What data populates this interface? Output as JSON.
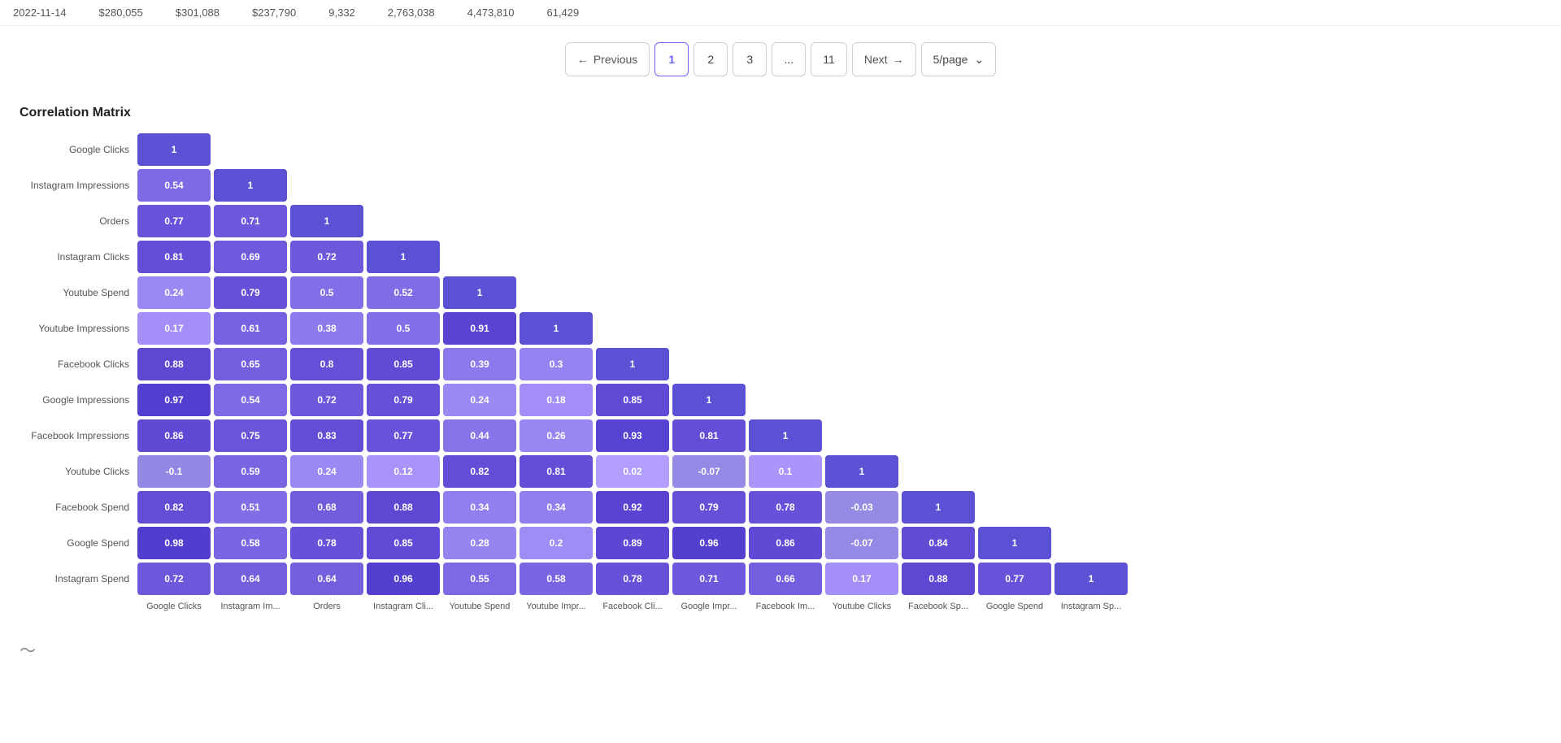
{
  "topRow": {
    "date": "2022-11-14",
    "col1": "$280,055",
    "col2": "$301,088",
    "col3": "$237,790",
    "col4": "9,332",
    "col5": "2,763,038",
    "col6": "4,473,810",
    "col7": "61,429"
  },
  "pagination": {
    "prev_label": "Previous",
    "next_label": "Next",
    "pages": [
      "1",
      "2",
      "3",
      "...",
      "11"
    ],
    "active_page": "1",
    "per_page": "5/page"
  },
  "section": {
    "title": "Correlation Matrix"
  },
  "matrix": {
    "rowLabels": [
      "Google Clicks",
      "Instagram Impressions",
      "Orders",
      "Instagram Clicks",
      "Youtube Spend",
      "Youtube Impressions",
      "Facebook Clicks",
      "Google Impressions",
      "Facebook Impressions",
      "Youtube Clicks",
      "Facebook Spend",
      "Google Spend",
      "Instagram Spend"
    ],
    "colLabels": [
      "Google Clicks",
      "Instagram Im...",
      "Orders",
      "Instagram Cli...",
      "Youtube Spend",
      "Youtube Impr...",
      "Facebook Cli...",
      "Google Impr...",
      "Facebook Im...",
      "Youtube Clicks",
      "Facebook Sp...",
      "Google Spend",
      "Instagram Sp..."
    ],
    "cells": [
      [
        1,
        null,
        null,
        null,
        null,
        null,
        null,
        null,
        null,
        null,
        null,
        null,
        null
      ],
      [
        0.54,
        1,
        null,
        null,
        null,
        null,
        null,
        null,
        null,
        null,
        null,
        null,
        null
      ],
      [
        0.77,
        0.71,
        1,
        null,
        null,
        null,
        null,
        null,
        null,
        null,
        null,
        null,
        null
      ],
      [
        0.81,
        0.69,
        0.72,
        1,
        null,
        null,
        null,
        null,
        null,
        null,
        null,
        null,
        null
      ],
      [
        0.24,
        0.79,
        0.5,
        0.52,
        1,
        null,
        null,
        null,
        null,
        null,
        null,
        null,
        null
      ],
      [
        0.17,
        0.61,
        0.38,
        0.5,
        0.91,
        1,
        null,
        null,
        null,
        null,
        null,
        null,
        null
      ],
      [
        0.88,
        0.65,
        0.8,
        0.85,
        0.39,
        0.3,
        1,
        null,
        null,
        null,
        null,
        null,
        null
      ],
      [
        0.97,
        0.54,
        0.72,
        0.79,
        0.24,
        0.18,
        0.85,
        1,
        null,
        null,
        null,
        null,
        null
      ],
      [
        0.86,
        0.75,
        0.83,
        0.77,
        0.44,
        0.26,
        0.93,
        0.81,
        1,
        null,
        null,
        null,
        null
      ],
      [
        -0.1,
        0.59,
        0.24,
        0.12,
        0.82,
        0.81,
        0.02,
        -0.07,
        0.1,
        1,
        null,
        null,
        null
      ],
      [
        0.82,
        0.51,
        0.68,
        0.88,
        0.34,
        0.34,
        0.92,
        0.79,
        0.78,
        -0.03,
        1,
        null,
        null
      ],
      [
        0.98,
        0.58,
        0.78,
        0.85,
        0.28,
        0.2,
        0.89,
        0.96,
        0.86,
        -0.07,
        0.84,
        1,
        null
      ],
      [
        0.72,
        0.64,
        0.64,
        0.96,
        0.55,
        0.58,
        0.78,
        0.71,
        0.66,
        0.17,
        0.88,
        0.77,
        1
      ]
    ]
  }
}
